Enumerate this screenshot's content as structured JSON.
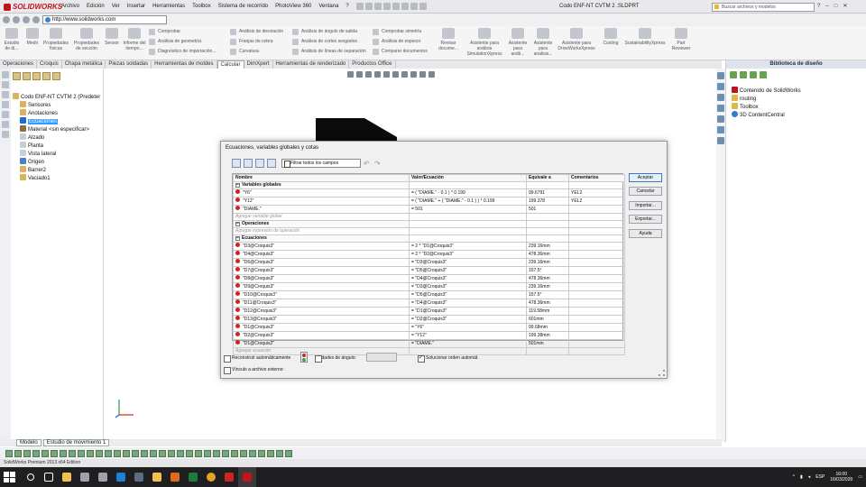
{
  "app": {
    "logo_text": "SOLIDWORKS",
    "menu": [
      "Archivo",
      "Edición",
      "Ver",
      "Insertar",
      "Herramientas",
      "Toolbox",
      "Sistema de recorrido",
      "PhotoView 360",
      "Ventana",
      "?"
    ],
    "document_title": "Codo ENF-NT CVTM 2 .SLDPRT",
    "search_placeholder": "Buscar archivos y modelos",
    "window_controls": [
      "?",
      "–",
      "□",
      "✕"
    ],
    "url": "http://www.solidworks.com"
  },
  "ribbon": {
    "big_buttons": [
      "Estudio de di...",
      "Medir",
      "Propiedades físicas",
      "Propiedades de sección",
      "Sensor",
      "Informe del tiempo...",
      "Revisar docume...",
      "Asistente para análisis SimulationXpress",
      "Asistente para análi...",
      "Asistente para análisis...",
      "Asistente para DriveWorksXpress",
      "Costing",
      "SustainabilityXpress",
      "Part Reviewer"
    ],
    "small_buttons": [
      "Comprobar",
      "Análisis de geometría",
      "Diagnóstico de importación...",
      "Análisis de desviación",
      "Franjas de cebra",
      "Curvatura",
      "Análisis de ángulo de salida",
      "Análisis de cortes sesgados",
      "Análisis de líneas de separación",
      "Comprobar simetría",
      "Análisis de espesor",
      "Comparar documentos"
    ]
  },
  "command_tabs": [
    "Operaciones",
    "Croquis",
    "Chapa metálica",
    "Piezas soldadas",
    "Herramientas de moldes",
    "Calcular",
    "DimXpert",
    "Herramientas de renderizado",
    "Productos Office"
  ],
  "active_tab": "Calcular",
  "feature_tree": {
    "items": [
      "Codo ENF-NT CVTM 2  (Predeter",
      "Sensores",
      "Anotaciones",
      "Ecuaciones",
      "Material <sin especificar>",
      "Alzado",
      "Planta",
      "Vista lateral",
      "Origen",
      "Barrer2",
      "Vaciado1"
    ],
    "selected": "Ecuaciones"
  },
  "design_library": {
    "title": "Biblioteca de diseño",
    "items": [
      "Contenido de SolidWorks",
      "routing",
      "Toolbox",
      "3D ContentCentral"
    ]
  },
  "dialog": {
    "title": "Ecuaciones, variables globales y cotas",
    "filter_label": "Filtrar todos los campos",
    "columns": [
      "Nombre",
      "Valor/Ecuación",
      "Equivale a",
      "Comentarios"
    ],
    "sections": {
      "globals": "Variables globales",
      "operations": "Operaciones",
      "equations": "Ecuaciones"
    },
    "globals": [
      {
        "name": "\"Y6\"",
        "value": "= ( \"DIAME.\" - 0.1 ) * 0.199",
        "equals": "99.6791",
        "comment": "YEL2"
      },
      {
        "name": "\"Y12\"",
        "value": "= ( \"DIAME.\" + ( \"DIAME.\" - 0.1 ) ) * 0.199",
        "equals": "199.378",
        "comment": "YEL2"
      },
      {
        "name": "\"DIAME.\"",
        "value": "= 501",
        "equals": "501",
        "comment": ""
      }
    ],
    "add_global": "Agregar variable global",
    "add_operation": "Agregar expresión de operación",
    "equations": [
      {
        "name": "\"D3@Croquis3\"",
        "value": "= 2 * \"D1@Croquis3\"",
        "equals": "239.16mm"
      },
      {
        "name": "\"D4@Croquis3\"",
        "value": "= 2 * \"D2@Croquis3\"",
        "equals": "478.36mm"
      },
      {
        "name": "\"D6@Croquis3\"",
        "value": "= \"D3@Croquis3\"",
        "equals": "239.16mm"
      },
      {
        "name": "\"D7@Croquis3\"",
        "value": "= \"D5@Croquis3\"",
        "equals": "157.5°"
      },
      {
        "name": "\"D8@Croquis3\"",
        "value": "= \"D4@Croquis3\"",
        "equals": "478.36mm"
      },
      {
        "name": "\"D9@Croquis3\"",
        "value": "= \"D3@Croquis3\"",
        "equals": "239.16mm"
      },
      {
        "name": "\"D10@Croquis3\"",
        "value": "= \"D5@Croquis3\"",
        "equals": "157.5°"
      },
      {
        "name": "\"D11@Croquis3\"",
        "value": "= \"D4@Croquis3\"",
        "equals": "478.36mm"
      },
      {
        "name": "\"D12@Croquis3\"",
        "value": "= \"D1@Croquis3\"",
        "equals": "119.58mm"
      },
      {
        "name": "\"D13@Croquis3\"",
        "value": "= \"D2@Croquis3\"",
        "equals": "601mm"
      },
      {
        "name": "\"D1@Croquis3\"",
        "value": "= \"Y6\"",
        "equals": "99.68mm"
      },
      {
        "name": "\"D2@Croquis3\"",
        "value": "= \"Y12\"",
        "equals": "199.38mm"
      },
      {
        "name": "\"D1@Croquis2\"",
        "value": "= \"DIAME.\"",
        "equals": "501mm"
      }
    ],
    "add_equation": "Agregar ecuación",
    "buttons": [
      "Aceptar",
      "Cancelar",
      "Importar...",
      "Exportar...",
      "Ayuda"
    ],
    "auto_rebuild": "Reconstruir automáticamente",
    "angle_units": "Unidades de ángulo:",
    "auto_solve": "Solucionar orden automát.",
    "link_external": "Vínculo a archivo externo:"
  },
  "bottom_tabs": [
    "Modelo",
    "Estudio de movimiento 1"
  ],
  "status": "SolidWorks Premium 2013 x64 Edition",
  "taskbar": {
    "lang": "ESP",
    "time": "16:00",
    "date": "16/03/2020",
    "icons": [
      "search",
      "task-view",
      "file-explorer",
      "taskbar-app",
      "taskbar-app",
      "edge",
      "store",
      "folder",
      "outlook",
      "excel",
      "chrome",
      "acrobat",
      "solidworks"
    ]
  },
  "colors": {
    "accent": "#3399ff",
    "error": "#c9261f",
    "brand": "#c0141e"
  }
}
